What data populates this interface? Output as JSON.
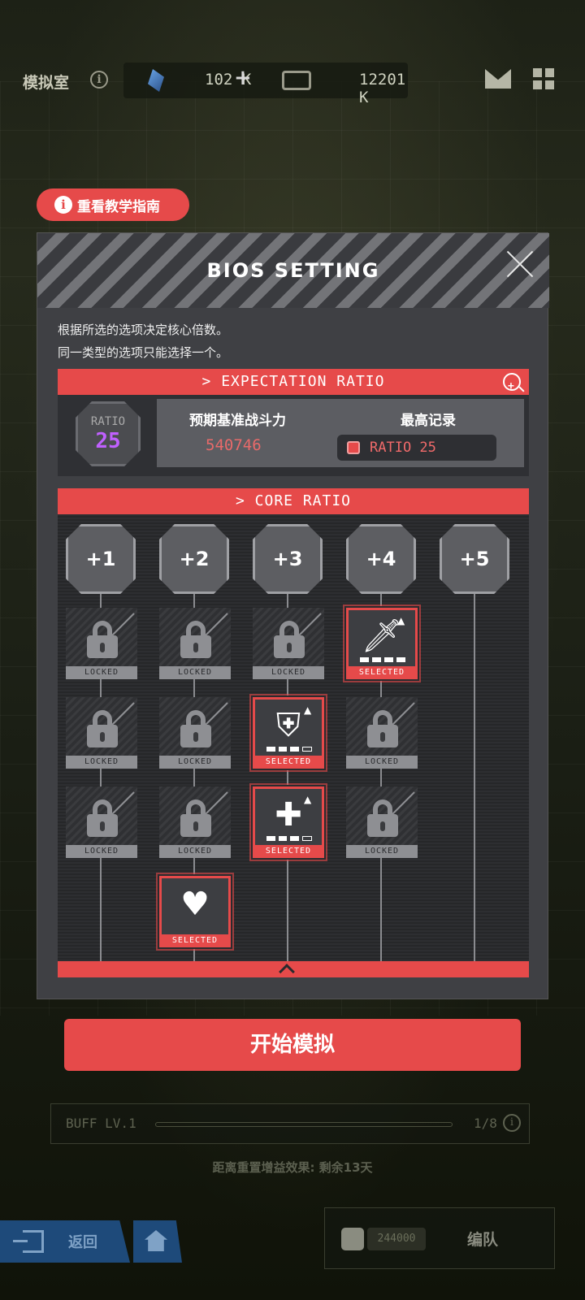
{
  "topbar": {
    "title": "模拟室",
    "resource1_value": "102 K",
    "resource1_plus": "+",
    "resource2_value": "12201 K",
    "info_glyph": "i"
  },
  "tutorial": {
    "label": "重看教学指南",
    "info_glyph": "i"
  },
  "modal": {
    "title": "BIOS SETTING",
    "desc1": "根据所选的选项决定核心倍数。",
    "desc2": "同一类型的选项只能选择一个。",
    "expectation": {
      "header": "> EXPECTATION RATIO",
      "ratio_label": "RATIO",
      "ratio_value": "25",
      "power_label": "预期基准战斗力",
      "power_value": "540746",
      "record_label": "最高记录",
      "record_value": "RATIO 25"
    },
    "core": {
      "header": "> CORE RATIO",
      "columns": [
        "+1",
        "+2",
        "+3",
        "+4",
        "+5"
      ],
      "locked_label": "LOCKED",
      "selected_label": "SELECTED",
      "selected_icons": {
        "sword": "sword-icon",
        "shield": "shield-icon",
        "heal": "heal-cross-icon",
        "broken_heart": "broken-heart-icon"
      }
    }
  },
  "start_button": "开始模拟",
  "buff": {
    "label": "BUFF LV.1",
    "count": "1/8",
    "info_glyph": "i"
  },
  "reset_text": "距离重置增益效果: 剩余13天",
  "bottom": {
    "back_label": "返回",
    "team_power": "244000",
    "team_label": "编队"
  },
  "colors": {
    "accent": "#e64a4a",
    "ratio_purple": "#c060ff",
    "nav_blue": "#1e4a7a"
  }
}
